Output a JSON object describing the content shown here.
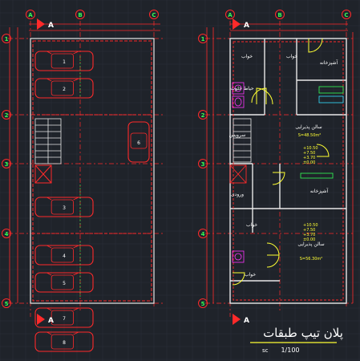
{
  "drawing": {
    "colors": {
      "background": "#1f232a",
      "grid": "#2b313a",
      "wall": "#e8e8e8",
      "red": "#ff2a2a",
      "green": "#33ff55",
      "yellow": "#ffff33",
      "cyan": "#33e0ff",
      "magenta": "#ff33ff"
    },
    "left_plan": {
      "grid_columns": [
        "A",
        "B",
        "C"
      ],
      "grid_rows": [
        "1",
        "2",
        "3",
        "4",
        "5"
      ],
      "car_labels": [
        "1",
        "2",
        "3",
        "4",
        "5",
        "6",
        "7",
        "8",
        "9"
      ]
    },
    "right_plan": {
      "grid_columns": [
        "A",
        "B",
        "C"
      ],
      "grid_rows": [
        "1",
        "2",
        "3",
        "4",
        "5"
      ],
      "room_labels": [
        "خواب",
        "خواب",
        "آشپزخانه",
        "حیاط خلوت",
        "سالن پذیرایی",
        "آشپزخانه",
        "ورودی",
        "سالن پذیرایی",
        "خواب",
        "خواب",
        "سرویس"
      ],
      "hall_areas": [
        "S=48.50m²",
        "S=56.30m²"
      ],
      "elevations": [
        "+10.50",
        "+7.50",
        "+3.70",
        "±0.00"
      ]
    },
    "section_marks": [
      "A",
      "A",
      "A",
      "A"
    ],
    "title_block": {
      "title": "پلان تیپ طبقات",
      "scale_label": "sc",
      "scale": "1/100"
    }
  }
}
